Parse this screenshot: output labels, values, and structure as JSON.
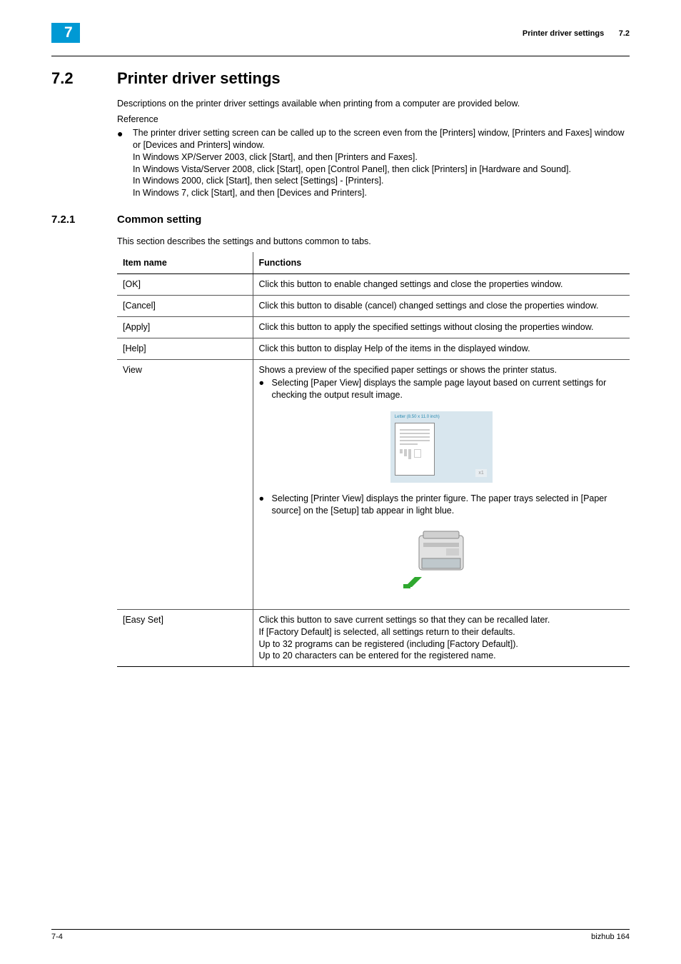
{
  "header": {
    "chapter_num": "7",
    "title": "Printer driver settings",
    "section_num_ref": "7.2"
  },
  "section": {
    "num": "7.2",
    "title": "Printer driver settings",
    "desc": "Descriptions on the printer driver settings available when printing from a computer are provided below.",
    "ref_label": "Reference",
    "bullet": "The printer driver setting screen can be called up to the screen even from the [Printers] window, [Printers and Faxes] window or [Devices and Printers] window.\nIn Windows XP/Server 2003, click [Start], and then [Printers and Faxes].\nIn Windows Vista/Server 2008, click [Start], open [Control Panel], then click [Printers] in [Hardware and Sound].\nIn Windows 2000, click [Start], then select [Settings] - [Printers].\nIn Windows 7, click [Start], and then [Devices and Printers]."
  },
  "subsection": {
    "num": "7.2.1",
    "title": "Common setting",
    "desc": "This section describes the settings and buttons common to tabs."
  },
  "table": {
    "headers": {
      "item": "Item name",
      "func": "Functions"
    },
    "rows": {
      "ok": {
        "name": "[OK]",
        "func": "Click this button to enable changed settings and close the properties window."
      },
      "cancel": {
        "name": "[Cancel]",
        "func": "Click this button to disable (cancel) changed settings and close the properties window."
      },
      "apply": {
        "name": "[Apply]",
        "func": "Click this button to apply the specified settings without closing the properties window."
      },
      "help": {
        "name": "[Help]",
        "func": "Click this button to display Help of the items in the displayed window."
      },
      "view": {
        "name": "View",
        "intro": "Shows a preview of the specified paper settings or shows the printer status.",
        "b1": "Selecting [Paper View] displays the sample page layout based on current settings for checking the output result image.",
        "pv_caption": "Letter (8.50 x 11.0 inch)",
        "pv_one": "x1",
        "b2": "Selecting [Printer View] displays the printer figure. The paper trays selected in [Paper source] on the [Setup] tab appear in light blue."
      },
      "easyset": {
        "name": "[Easy Set]",
        "func": "Click this button to save current settings so that they can be recalled later.\nIf [Factory Default] is selected, all settings return to their defaults.\nUp to 32 programs can be registered (including [Factory Default]).\nUp to 20 characters can be entered for the registered name."
      }
    }
  },
  "footer": {
    "page": "7-4",
    "product": "bizhub 164"
  }
}
